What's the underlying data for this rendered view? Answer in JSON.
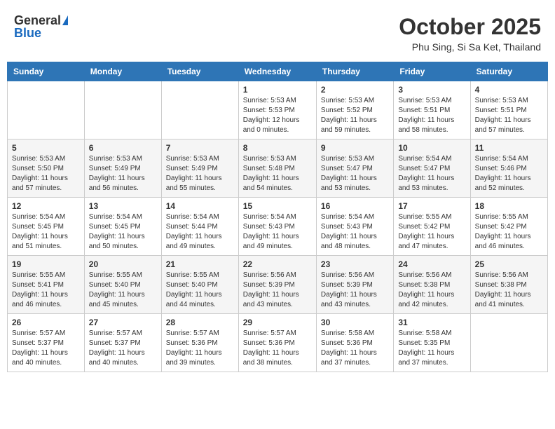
{
  "header": {
    "logo_general": "General",
    "logo_blue": "Blue",
    "month_title": "October 2025",
    "location": "Phu Sing, Si Sa Ket, Thailand"
  },
  "calendar": {
    "days_of_week": [
      "Sunday",
      "Monday",
      "Tuesday",
      "Wednesday",
      "Thursday",
      "Friday",
      "Saturday"
    ],
    "weeks": [
      [
        {
          "day": "",
          "info": ""
        },
        {
          "day": "",
          "info": ""
        },
        {
          "day": "",
          "info": ""
        },
        {
          "day": "1",
          "info": "Sunrise: 5:53 AM\nSunset: 5:53 PM\nDaylight: 12 hours\nand 0 minutes."
        },
        {
          "day": "2",
          "info": "Sunrise: 5:53 AM\nSunset: 5:52 PM\nDaylight: 11 hours\nand 59 minutes."
        },
        {
          "day": "3",
          "info": "Sunrise: 5:53 AM\nSunset: 5:51 PM\nDaylight: 11 hours\nand 58 minutes."
        },
        {
          "day": "4",
          "info": "Sunrise: 5:53 AM\nSunset: 5:51 PM\nDaylight: 11 hours\nand 57 minutes."
        }
      ],
      [
        {
          "day": "5",
          "info": "Sunrise: 5:53 AM\nSunset: 5:50 PM\nDaylight: 11 hours\nand 57 minutes."
        },
        {
          "day": "6",
          "info": "Sunrise: 5:53 AM\nSunset: 5:49 PM\nDaylight: 11 hours\nand 56 minutes."
        },
        {
          "day": "7",
          "info": "Sunrise: 5:53 AM\nSunset: 5:49 PM\nDaylight: 11 hours\nand 55 minutes."
        },
        {
          "day": "8",
          "info": "Sunrise: 5:53 AM\nSunset: 5:48 PM\nDaylight: 11 hours\nand 54 minutes."
        },
        {
          "day": "9",
          "info": "Sunrise: 5:53 AM\nSunset: 5:47 PM\nDaylight: 11 hours\nand 53 minutes."
        },
        {
          "day": "10",
          "info": "Sunrise: 5:54 AM\nSunset: 5:47 PM\nDaylight: 11 hours\nand 53 minutes."
        },
        {
          "day": "11",
          "info": "Sunrise: 5:54 AM\nSunset: 5:46 PM\nDaylight: 11 hours\nand 52 minutes."
        }
      ],
      [
        {
          "day": "12",
          "info": "Sunrise: 5:54 AM\nSunset: 5:45 PM\nDaylight: 11 hours\nand 51 minutes."
        },
        {
          "day": "13",
          "info": "Sunrise: 5:54 AM\nSunset: 5:45 PM\nDaylight: 11 hours\nand 50 minutes."
        },
        {
          "day": "14",
          "info": "Sunrise: 5:54 AM\nSunset: 5:44 PM\nDaylight: 11 hours\nand 49 minutes."
        },
        {
          "day": "15",
          "info": "Sunrise: 5:54 AM\nSunset: 5:43 PM\nDaylight: 11 hours\nand 49 minutes."
        },
        {
          "day": "16",
          "info": "Sunrise: 5:54 AM\nSunset: 5:43 PM\nDaylight: 11 hours\nand 48 minutes."
        },
        {
          "day": "17",
          "info": "Sunrise: 5:55 AM\nSunset: 5:42 PM\nDaylight: 11 hours\nand 47 minutes."
        },
        {
          "day": "18",
          "info": "Sunrise: 5:55 AM\nSunset: 5:42 PM\nDaylight: 11 hours\nand 46 minutes."
        }
      ],
      [
        {
          "day": "19",
          "info": "Sunrise: 5:55 AM\nSunset: 5:41 PM\nDaylight: 11 hours\nand 46 minutes."
        },
        {
          "day": "20",
          "info": "Sunrise: 5:55 AM\nSunset: 5:40 PM\nDaylight: 11 hours\nand 45 minutes."
        },
        {
          "day": "21",
          "info": "Sunrise: 5:55 AM\nSunset: 5:40 PM\nDaylight: 11 hours\nand 44 minutes."
        },
        {
          "day": "22",
          "info": "Sunrise: 5:56 AM\nSunset: 5:39 PM\nDaylight: 11 hours\nand 43 minutes."
        },
        {
          "day": "23",
          "info": "Sunrise: 5:56 AM\nSunset: 5:39 PM\nDaylight: 11 hours\nand 43 minutes."
        },
        {
          "day": "24",
          "info": "Sunrise: 5:56 AM\nSunset: 5:38 PM\nDaylight: 11 hours\nand 42 minutes."
        },
        {
          "day": "25",
          "info": "Sunrise: 5:56 AM\nSunset: 5:38 PM\nDaylight: 11 hours\nand 41 minutes."
        }
      ],
      [
        {
          "day": "26",
          "info": "Sunrise: 5:57 AM\nSunset: 5:37 PM\nDaylight: 11 hours\nand 40 minutes."
        },
        {
          "day": "27",
          "info": "Sunrise: 5:57 AM\nSunset: 5:37 PM\nDaylight: 11 hours\nand 40 minutes."
        },
        {
          "day": "28",
          "info": "Sunrise: 5:57 AM\nSunset: 5:36 PM\nDaylight: 11 hours\nand 39 minutes."
        },
        {
          "day": "29",
          "info": "Sunrise: 5:57 AM\nSunset: 5:36 PM\nDaylight: 11 hours\nand 38 minutes."
        },
        {
          "day": "30",
          "info": "Sunrise: 5:58 AM\nSunset: 5:36 PM\nDaylight: 11 hours\nand 37 minutes."
        },
        {
          "day": "31",
          "info": "Sunrise: 5:58 AM\nSunset: 5:35 PM\nDaylight: 11 hours\nand 37 minutes."
        },
        {
          "day": "",
          "info": ""
        }
      ]
    ]
  }
}
